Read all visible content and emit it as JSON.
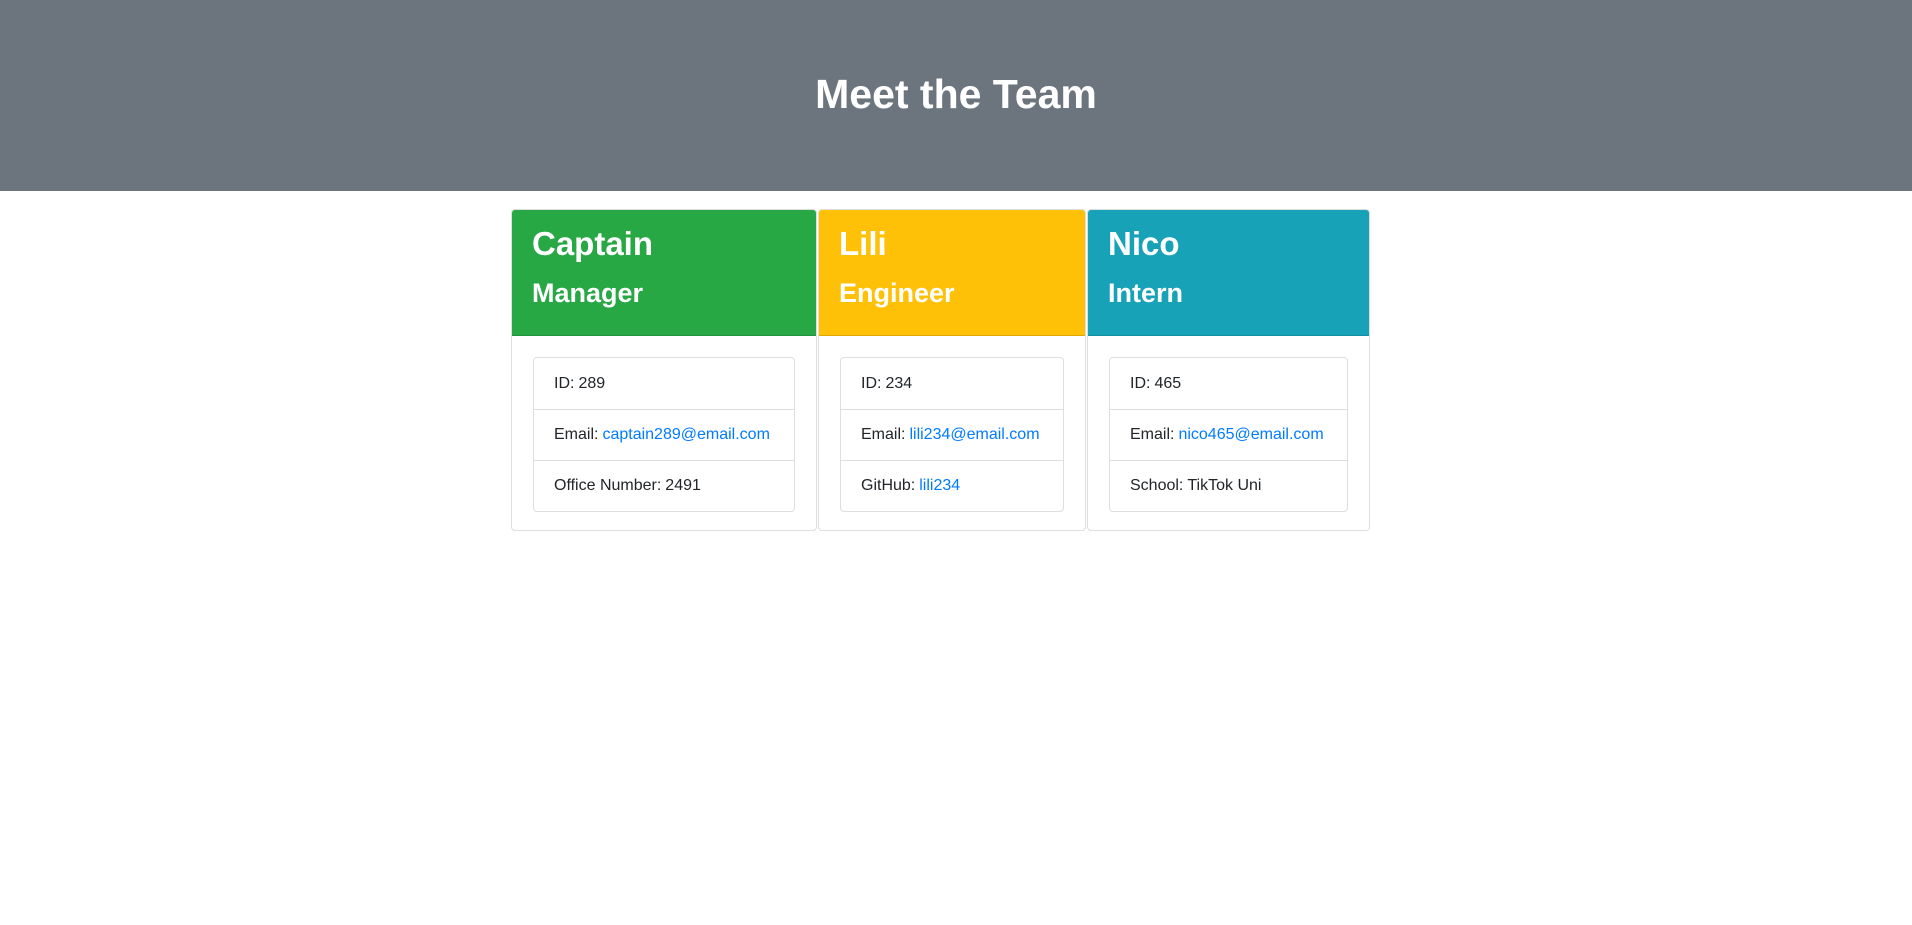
{
  "header": {
    "title": "Meet the Team"
  },
  "team": {
    "manager": {
      "name": "Captain",
      "role": "Manager",
      "id_label": "ID:",
      "id": "289",
      "email_label": "Email:",
      "email": "captain289@email.com",
      "extra_label": "Office Number:",
      "extra": "2491",
      "color": "#28a745"
    },
    "engineer": {
      "name": "Lili",
      "role": "Engineer",
      "id_label": "ID:",
      "id": "234",
      "email_label": "Email:",
      "email": "lili234@email.com",
      "extra_label": "GitHub:",
      "extra": "lili234",
      "color": "#ffc107"
    },
    "intern": {
      "name": "Nico",
      "role": "Intern",
      "id_label": "ID:",
      "id": "465",
      "email_label": "Email:",
      "email": "nico465@email.com",
      "extra_label": "School:",
      "extra": "TikTok Uni",
      "color": "#17a2b8"
    }
  },
  "colors": {
    "header_bg": "#6c757d",
    "link": "#007bff"
  }
}
